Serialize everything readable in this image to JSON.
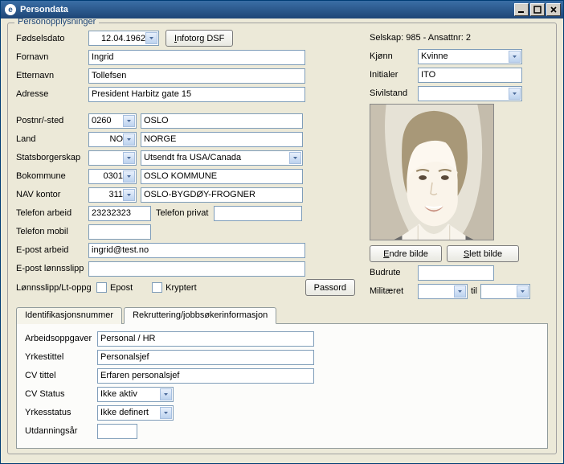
{
  "window": {
    "title": "Persondata"
  },
  "fieldset": {
    "legend": "Personopplysninger"
  },
  "labels": {
    "fodselsdato": "Fødselsdato",
    "fornavn": "Fornavn",
    "etternavn": "Etternavn",
    "adresse": "Adresse",
    "postnr": "Postnr/-sted",
    "land": "Land",
    "statsborgerskap": "Statsborgerskap",
    "bokommune": "Bokommune",
    "navkontor": "NAV kontor",
    "telefon_arbeid": "Telefon arbeid",
    "telefon_privat": "Telefon privat",
    "telefon_mobil": "Telefon mobil",
    "epost_arbeid": "E-post arbeid",
    "epost_lonn": "E-post lønnsslipp",
    "lonnsslipp": "Lønnsslipp/Lt-oppg",
    "epost_cb": "Epost",
    "kryptert": "Kryptert",
    "selskap": "Selskap: 985 - Ansattnr:  2",
    "kjonn": "Kjønn",
    "initialer": "Initialer",
    "sivilstand": "Sivilstand",
    "budrute": "Budrute",
    "militaret": "Militæret",
    "til": "til"
  },
  "values": {
    "fodselsdato": "12.04.1962",
    "fornavn": "Ingrid",
    "etternavn": "Tollefsen",
    "adresse": "President Harbitz gate 15",
    "postnr": "0260",
    "poststed": "OSLO",
    "land_kode": "NO",
    "land_navn": "NORGE",
    "statsborgerskap_kode": "",
    "statsborgerskap_navn": "Utsendt fra USA/Canada",
    "bokommune_kode": "0301",
    "bokommune_navn": "OSLO KOMMUNE",
    "navkontor_kode": "311",
    "navkontor_navn": "OSLO-BYGDØY-FROGNER",
    "telefon_arbeid": "23232323",
    "telefon_privat": "",
    "telefon_mobil": "",
    "epost_arbeid": "ingrid@test.no",
    "epost_lonn": "",
    "kjonn": "Kvinne",
    "initialer": "ITO",
    "sivilstand": "",
    "budrute": "",
    "militaret_fra": "",
    "militaret_til": ""
  },
  "buttons": {
    "infotorg": "Infotorg DSF",
    "passord": "Passord",
    "endre_bilde": "Endre bilde",
    "slett_bilde": "Slett bilde"
  },
  "tabs": {
    "id": "Identifikasjonsnummer",
    "rekr": "Rekruttering/jobbsøkerinformasjon"
  },
  "rekr": {
    "labels": {
      "arbeidsoppgaver": "Arbeidsoppgaver",
      "yrkestittel": "Yrkestittel",
      "cvtittel": "CV tittel",
      "cvstatus": "CV Status",
      "yrkesstatus": "Yrkesstatus",
      "utdanningsar": "Utdanningsår"
    },
    "values": {
      "arbeidsoppgaver": "Personal / HR",
      "yrkestittel": "Personalsjef",
      "cvtittel": "Erfaren personalsjef",
      "cvstatus": "Ikke aktiv",
      "yrkesstatus": "Ikke definert",
      "utdanningsar": ""
    }
  }
}
